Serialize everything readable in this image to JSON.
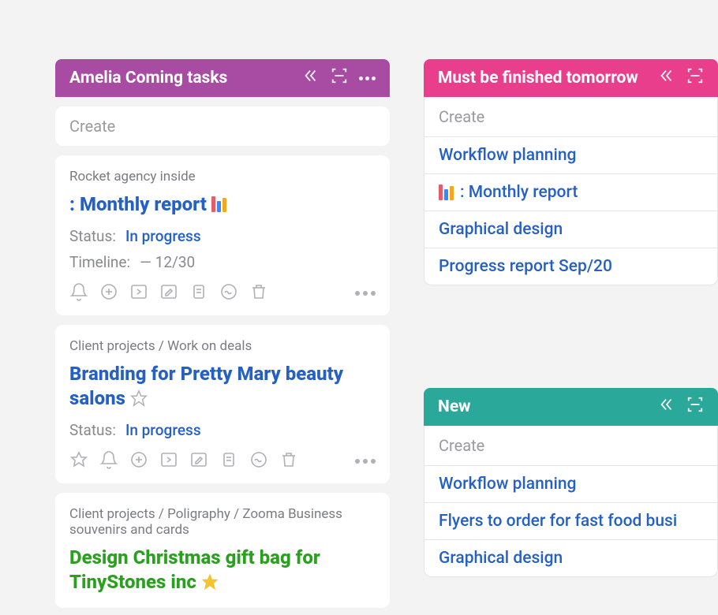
{
  "columns": {
    "amelia": {
      "title": "Amelia Coming tasks",
      "create_placeholder": "Create",
      "cards": [
        {
          "breadcrumb": "Rocket agency inside",
          "title_prefix": ": ",
          "title": "Monthly report",
          "has_chart_icon": true,
          "status_label": "Status:",
          "status_value": "In progress",
          "timeline_label": "Timeline:",
          "timeline_value": "— 12/30"
        },
        {
          "breadcrumb": "Client projects / Work on deals",
          "title": "Branding for Pretty Mary beauty salons",
          "has_star": true,
          "status_label": "Status:",
          "status_value": "In progress"
        },
        {
          "breadcrumb": "Client projects / Poligraphy / Zooma Business souvenirs and cards",
          "title": "Design Christmas gift bag for TinyStones inc",
          "title_class": "green",
          "has_filled_star": true
        }
      ]
    },
    "tomorrow": {
      "title": "Must be finished tomorrow",
      "create_placeholder": "Create",
      "items": [
        {
          "label": "Workflow planning"
        },
        {
          "label": ": Monthly report",
          "has_chart_icon": true
        },
        {
          "label": "Graphical design"
        },
        {
          "label": "Progress report Sep/20"
        }
      ]
    },
    "new": {
      "title": "New",
      "create_placeholder": "Create",
      "items": [
        {
          "label": "Workflow planning"
        },
        {
          "label": "Flyers to order for fast food busi"
        },
        {
          "label": "Graphical design"
        }
      ]
    }
  }
}
